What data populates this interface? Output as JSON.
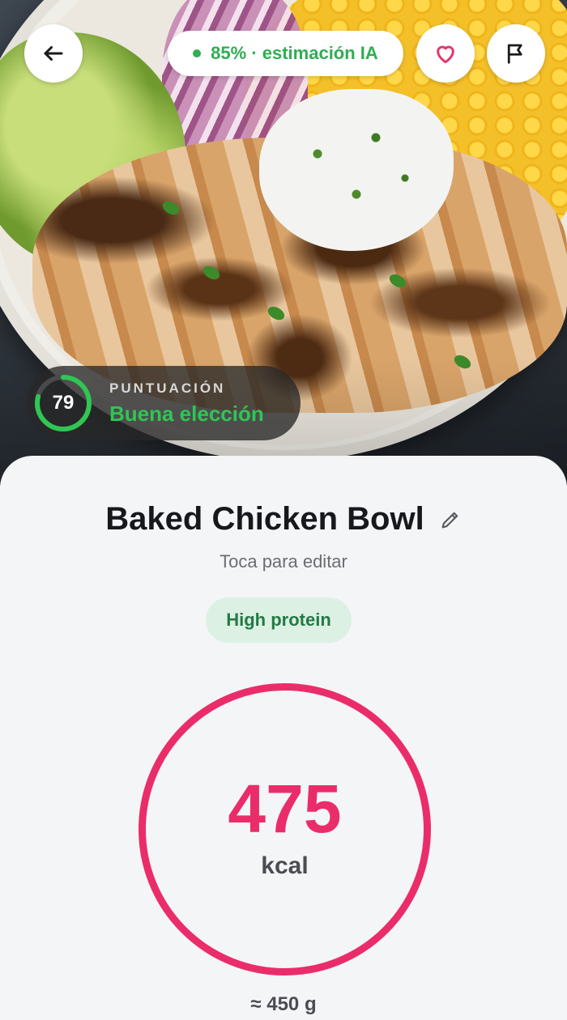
{
  "header": {
    "back_icon": "arrow-left-icon",
    "ai_estimate": "85% · estimación IA",
    "favorite_icon": "heart-icon",
    "report_icon": "flag-icon",
    "accent_color": "#2fae52",
    "heart_color": "#e0376a"
  },
  "score": {
    "value": "79",
    "fraction": 0.79,
    "label": "PUNTUACIÓN",
    "verdict": "Buena elección",
    "color": "#2fc654"
  },
  "meal": {
    "name": "Baked Chicken Bowl",
    "edit_hint": "Toca para editar",
    "edit_icon": "pencil-icon",
    "tag": "High protein"
  },
  "calories": {
    "value": "475",
    "unit": "kcal",
    "ring_color": "#ea2d6a"
  },
  "portion": {
    "weight": "≈ 450 g"
  }
}
